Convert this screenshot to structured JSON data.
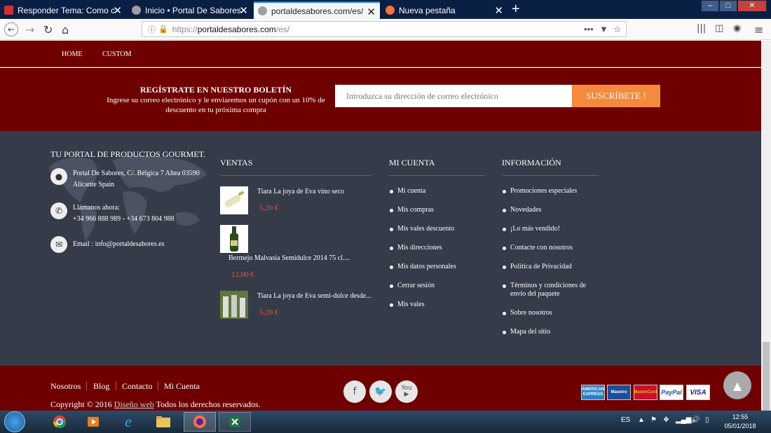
{
  "browser": {
    "tabs": [
      {
        "title": "Responder Tema: Como camb",
        "favicon_color": "#d32f2f"
      },
      {
        "title": "Inicio • Portal De Sabores",
        "favicon_color": "#9e9e9e"
      },
      {
        "title": "portaldesabores.com/es/",
        "favicon_color": "#9e9e9e"
      },
      {
        "title": "Nueva pestaña",
        "favicon_color": "#ff7139"
      }
    ],
    "url": {
      "scheme": "https://",
      "host": "portaldesabores.com",
      "path": "/es/"
    }
  },
  "site": {
    "topnav": [
      "HOME",
      "CUSTOM"
    ],
    "newsletter": {
      "title": "REGÍSTRATE EN NUESTRO BOLETÍN",
      "desc": "Ingrese su correo electrónico y le enviaremos un cupón con un 10% de descuento en tu próxima compra",
      "placeholder": "Introduzca su dirección de correo electrónico",
      "button": "SUSCRÍBETE !"
    },
    "footer": {
      "about_title": "TU PORTAL DE PRODUCTOS GOURMET.",
      "address_line1": "Portal De Sabores, C/. Bélgica 7 Altea 03590",
      "address_line2": "Alicante Spain",
      "phone_label": "Llámanos ahora:",
      "phone": "+34 966 888 989 - +34 673 804 988",
      "email": "Email : info@portaldesabores.es",
      "ventas_title": "VENTAS",
      "products": [
        {
          "name": "Tiara La joya de Eva vino seco",
          "price": "5,20 €"
        },
        {
          "name": "Bermejo Malvasía Semidulce 2014 75 cl....",
          "price": "12,00 €"
        },
        {
          "name": "Tiara La joya de Eva semi-dulce desde...",
          "price": "5,20 €"
        }
      ],
      "account_title": "MI CUENTA",
      "account_links": [
        "Mi cuenta",
        "Mis compras",
        "Mis vales descuento",
        "Mis direcciones",
        "Mis datos personales",
        "Cerrar sesión",
        "Mis vales"
      ],
      "info_title": "INFORMACIÓN",
      "info_links": [
        "Promociones especiales",
        "Novedades",
        "¡Lo más vendido!",
        "Contacte con nosotros",
        "Política de Privacidad",
        "Términos y condiciones de envío del paquete",
        "Sobre nosotros",
        "Mapa del sitio"
      ]
    },
    "bottom": {
      "links": [
        "Nosotros",
        "Blog",
        "Contacto",
        "Mi Cuenta"
      ],
      "copyright_pre": "Copyright © 2016",
      "copyright_link": "Diseño web",
      "copyright_post": "Todos los derechos reservados.",
      "payments": [
        "AMERICAN EXPRESS",
        "Maestro",
        "MasterCard",
        "PayPal",
        "VISA"
      ]
    }
  },
  "taskbar": {
    "lang": "ES",
    "time": "12:55",
    "date": "05/01/2018"
  },
  "colors": {
    "brand": "#6e0000",
    "footer_bg": "#353b48",
    "accent": "#f5893c",
    "price": "#e8553a"
  }
}
